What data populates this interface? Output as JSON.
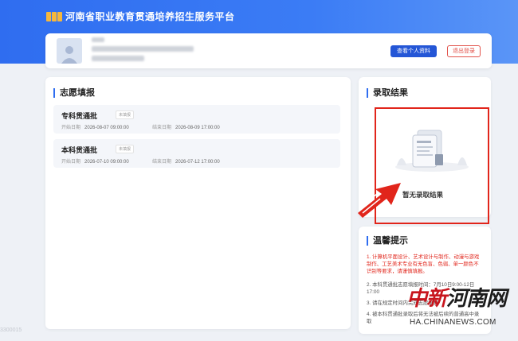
{
  "header": {
    "platform_title": "河南省职业教育贯通培养招生服务平台"
  },
  "user": {
    "view_profile_label": "查看个人资料",
    "logout_label": "退出登录"
  },
  "volunteer": {
    "title": "志愿填报",
    "items": [
      {
        "name": "专科贯通批",
        "status": "未填报",
        "start_label": "开始日期",
        "start": "2026-08-07 09:00:00",
        "end_label": "结束日期",
        "end": "2026-08-09 17:00:00"
      },
      {
        "name": "本科贯通批",
        "status": "未填报",
        "start_label": "开始日期",
        "start": "2026-07-10 09:00:00",
        "end_label": "结束日期",
        "end": "2026-07-12 17:00:00"
      }
    ]
  },
  "admission": {
    "title": "录取结果",
    "empty_text": "暂无录取结果"
  },
  "tips": {
    "title": "温馨提示",
    "items": [
      "1. 计算机平面设计、艺术设计与制作、动漫与游戏制作、工艺美术专业有无色盲、色弱、单一颜色不识别等要求，请谨慎填报。",
      "2. 本科贯通批志愿填报时间：7月10日9:00-12日17:00",
      "3. 请在规定时间内完成志愿填报",
      "4. 被本科贯通批录取后将无法被后续的普通高中录取"
    ]
  },
  "watermark": {
    "cn_red": "中新",
    "cn_black": "河南网",
    "en": "HA.CHINANEWS.COM"
  },
  "background_code": "3300015"
}
